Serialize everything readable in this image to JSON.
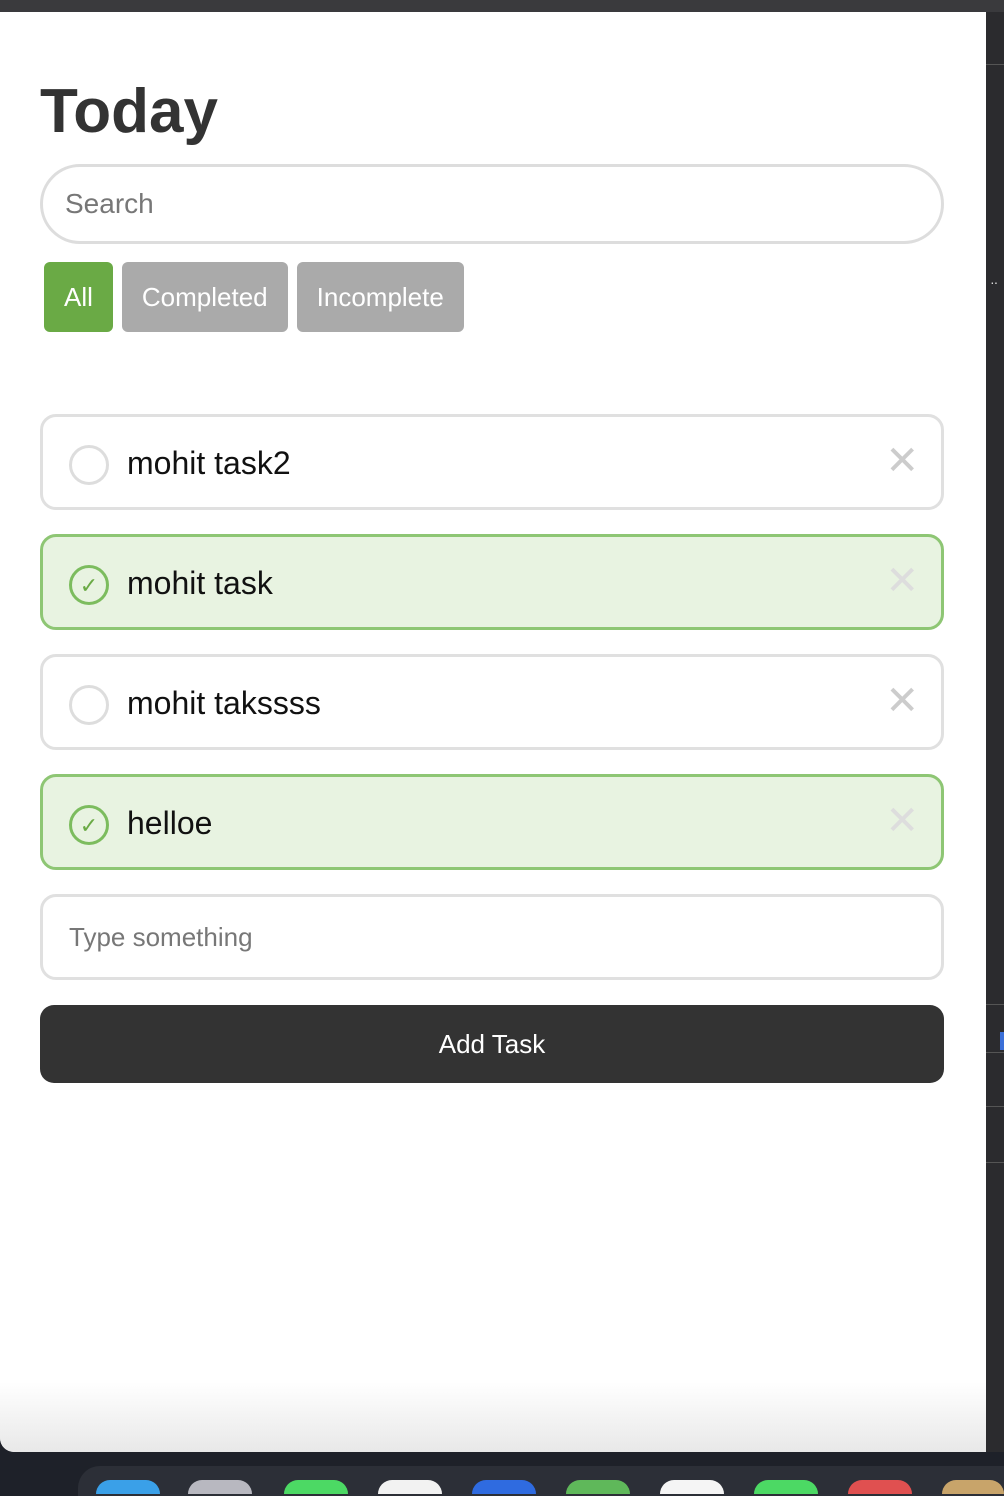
{
  "page": {
    "title": "Today"
  },
  "search": {
    "placeholder": "Search"
  },
  "filters": [
    {
      "label": "All",
      "active": true
    },
    {
      "label": "Completed",
      "active": false
    },
    {
      "label": "Incomplete",
      "active": false
    }
  ],
  "tasks": [
    {
      "text": "mohit task2",
      "completed": false
    },
    {
      "text": "mohit task",
      "completed": true
    },
    {
      "text": "mohit takssss",
      "completed": false
    },
    {
      "text": "helloe",
      "completed": true
    }
  ],
  "new_task": {
    "placeholder": "Type something"
  },
  "add_button": {
    "label": "Add Task"
  },
  "icons": {
    "check": "checkmark-icon",
    "delete": "close-icon"
  },
  "colors": {
    "accent": "#6aaa45",
    "filter_inactive": "#aaaaaa",
    "completed_bg": "#e8f3e1",
    "completed_border": "#8ec674",
    "button_dark": "#333333"
  }
}
